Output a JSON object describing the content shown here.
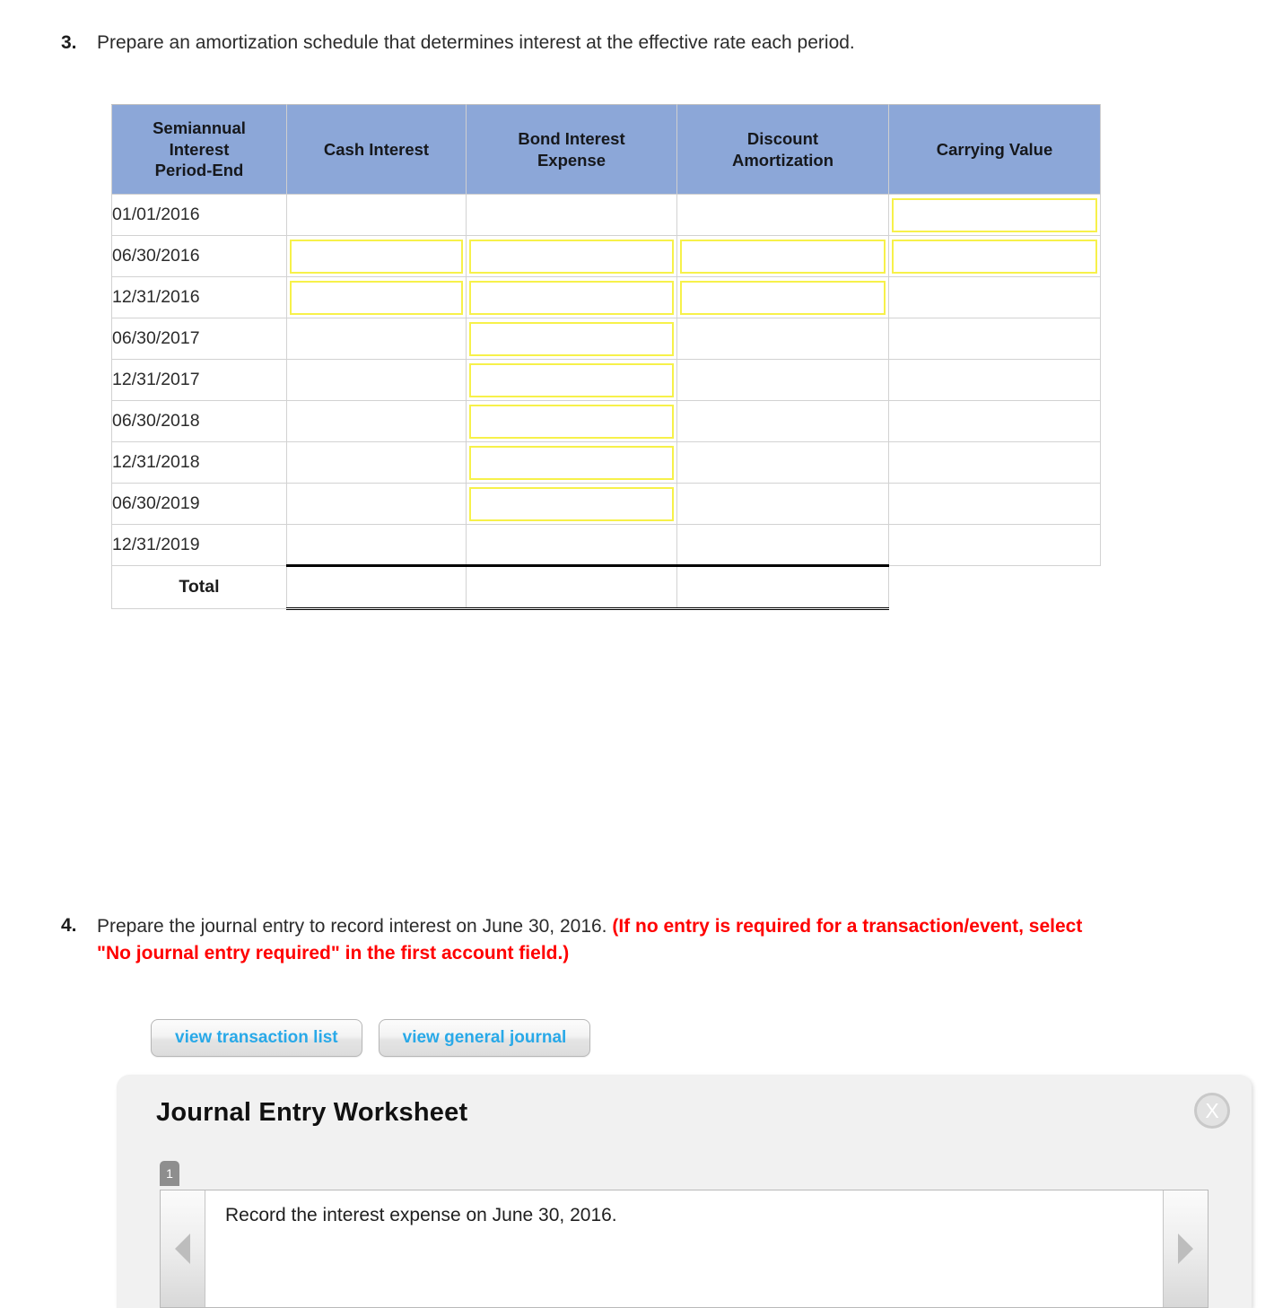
{
  "question3": {
    "number": "3.",
    "text": "Prepare an amortization schedule that determines interest at the effective rate each period."
  },
  "amortization_table": {
    "headers": [
      "Semiannual Interest Period-End",
      "Cash Interest",
      "Bond Interest Expense",
      "Discount Amortization",
      "Carrying Value"
    ],
    "header_lines": {
      "col0": [
        "Semiannual",
        "Interest",
        "Period-End"
      ],
      "col1": [
        "Cash Interest"
      ],
      "col2": [
        "Bond Interest",
        "Expense"
      ],
      "col3": [
        "Discount",
        "Amortization"
      ],
      "col4": [
        "Carrying Value"
      ]
    },
    "header_bg": "#8CA7D8",
    "input_border_color": "#F7F14A",
    "rows": [
      {
        "label": "01/01/2016",
        "cells": [
          "blank",
          "blank",
          "blank",
          "input"
        ]
      },
      {
        "label": "06/30/2016",
        "cells": [
          "input",
          "input",
          "input",
          "input"
        ]
      },
      {
        "label": "12/31/2016",
        "cells": [
          "input",
          "input",
          "input",
          "blank"
        ]
      },
      {
        "label": "06/30/2017",
        "cells": [
          "blank",
          "input",
          "blank",
          "blank"
        ]
      },
      {
        "label": "12/31/2017",
        "cells": [
          "blank",
          "input",
          "blank",
          "blank"
        ]
      },
      {
        "label": "06/30/2018",
        "cells": [
          "blank",
          "input",
          "blank",
          "blank"
        ]
      },
      {
        "label": "12/31/2018",
        "cells": [
          "blank",
          "input",
          "blank",
          "blank"
        ]
      },
      {
        "label": "06/30/2019",
        "cells": [
          "blank",
          "input",
          "blank",
          "blank"
        ]
      },
      {
        "label": "12/31/2019",
        "cells": [
          "blank",
          "blank",
          "blank",
          "blank"
        ]
      }
    ],
    "total_row": {
      "label": "Total",
      "cells": [
        "sum",
        "sum",
        "sum",
        "none"
      ]
    }
  },
  "question4": {
    "number": "4.",
    "text_plain": "Prepare the journal entry to record interest on June 30, 2016. ",
    "text_warning": "(If no entry is required for a transaction/event, select \"No journal entry required\" in the first account field.)",
    "warning_color": "#FF0000"
  },
  "buttons": {
    "view_transaction_list": "view transaction list",
    "view_general_journal": "view general journal",
    "link_color": "#29A9E8"
  },
  "worksheet": {
    "title": "Journal Entry Worksheet",
    "close_icon": "close-icon",
    "close_glyph": "X",
    "tab_label": "1",
    "description": "Record the interest expense on June 30, 2016.",
    "prev_icon": "chevron-left-icon",
    "next_icon": "chevron-right-icon",
    "panel_bg": "#F1F1F1"
  }
}
